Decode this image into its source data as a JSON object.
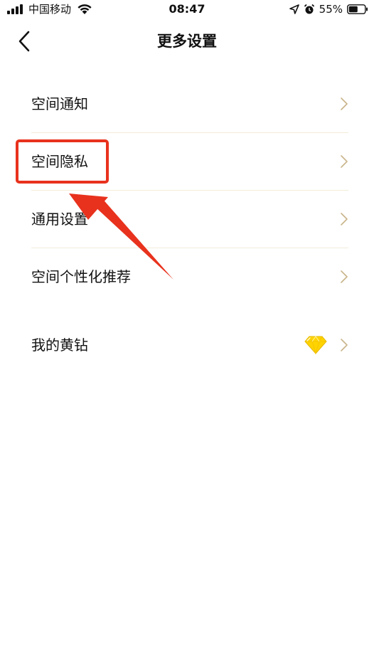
{
  "status_bar": {
    "carrier": "中国移动",
    "time": "08:47",
    "battery_percent": "55%",
    "icons": [
      "signal-icon",
      "wifi-icon",
      "location-icon",
      "alarm-icon",
      "battery-icon"
    ]
  },
  "nav": {
    "title": "更多设置",
    "back_icon": "chevron-left-icon"
  },
  "settings": {
    "items": [
      {
        "label": "空间通知"
      },
      {
        "label": "空间隐私"
      },
      {
        "label": "通用设置"
      },
      {
        "label": "空间个性化推荐"
      },
      {
        "label": "我的黄钻",
        "badge_icon": "yellow-diamond-icon"
      }
    ]
  },
  "colors": {
    "highlight": "#e8321d",
    "divider": "#f2ecda",
    "chevron": "#c9b48a",
    "diamond": "#ffd400"
  }
}
